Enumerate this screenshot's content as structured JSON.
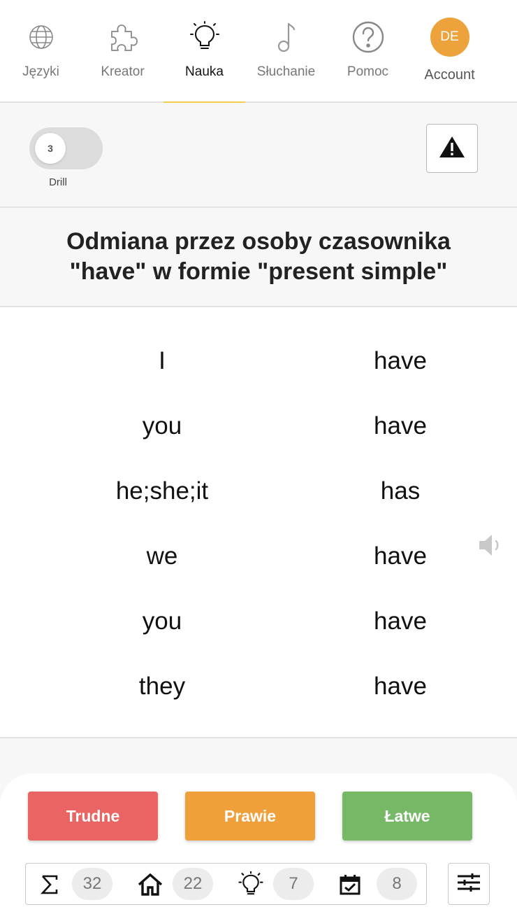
{
  "nav": {
    "items": [
      {
        "label": "Języki",
        "icon": "globe-icon"
      },
      {
        "label": "Kreator",
        "icon": "puzzle-icon"
      },
      {
        "label": "Nauka",
        "icon": "lightbulb-icon"
      },
      {
        "label": "Słuchanie",
        "icon": "music-note-icon"
      },
      {
        "label": "Pomoc",
        "icon": "help-icon"
      },
      {
        "label": "Account",
        "avatar": "DE"
      }
    ],
    "active": "Nauka",
    "accent_color": "#f1cf4a",
    "avatar_color": "#eea23c"
  },
  "toolbar": {
    "drill_count": "3",
    "drill_label": "Drill",
    "warning_icon": "warning-icon"
  },
  "title": "Odmiana przez osoby czasownika \"have\" w formie \"present simple\"",
  "table": {
    "rows": [
      {
        "left": "I",
        "right": "have"
      },
      {
        "left": "you",
        "right": "have"
      },
      {
        "left": "he;she;it",
        "right": "has"
      },
      {
        "left": "we",
        "right": "have"
      },
      {
        "left": "you",
        "right": "have"
      },
      {
        "left": "they",
        "right": "have"
      }
    ],
    "audio_icon": "speaker-icon"
  },
  "rating": {
    "hard": {
      "label": "Trudne",
      "color": "#e96463"
    },
    "almost": {
      "label": "Prawie",
      "color": "#f0a03a"
    },
    "easy": {
      "label": "Łatwe",
      "color": "#76b865"
    }
  },
  "stats": {
    "total": {
      "icon": "sigma-icon",
      "value": "32"
    },
    "home": {
      "icon": "home-icon",
      "value": "22"
    },
    "learning": {
      "icon": "lightbulb-icon",
      "value": "7"
    },
    "scheduled": {
      "icon": "calendar-check-icon",
      "value": "8"
    }
  },
  "settings_icon": "sliders-icon"
}
